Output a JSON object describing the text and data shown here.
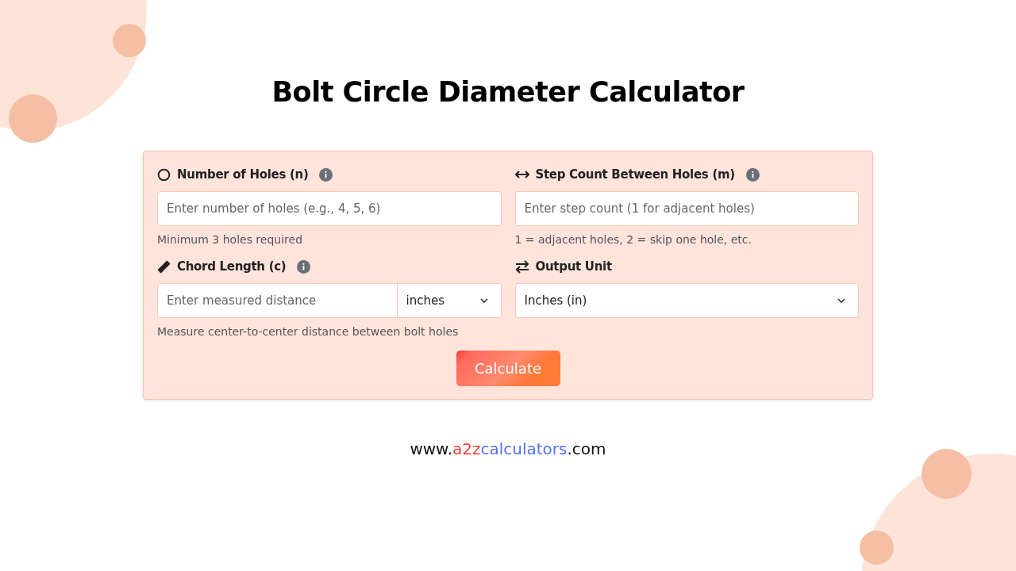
{
  "title": "Bolt Circle Diameter Calculator",
  "fields": [
    {
      "kind": "text",
      "label": "Number of Holes (n)",
      "info": true,
      "placeholder": "Enter number of holes (e.g., 4, 5, 6)",
      "hint": "Minimum 3 holes required"
    },
    {
      "kind": "text",
      "label": "Step Count Between Holes (m)",
      "info": true,
      "placeholder": "Enter step count (1 for adjacent holes)",
      "hint": "1 = adjacent holes, 2 = skip one hole, etc."
    },
    {
      "kind": "text-unit",
      "label": "Chord Length (c)",
      "info": true,
      "placeholder": "Enter measured distance",
      "unit": "inches",
      "hint": "Measure center-to-center distance between bolt holes"
    },
    {
      "kind": "select",
      "label": "Output Unit",
      "info": false,
      "value": "Inches (in)"
    }
  ],
  "button": "Calculate",
  "footer": [
    {
      "text": "www.",
      "color": "#111111"
    },
    {
      "text": "a2z",
      "color": "#ef4136"
    },
    {
      "text": "calculators",
      "color": "#5271ff"
    },
    {
      "text": ".com",
      "color": "#111111"
    }
  ]
}
